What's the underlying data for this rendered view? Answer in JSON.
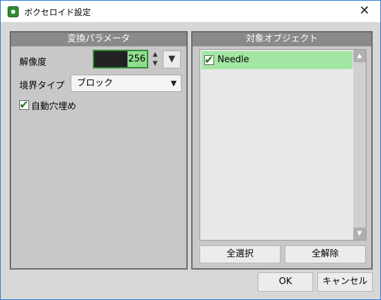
{
  "window": {
    "title": "ボクセロイド設定",
    "close_label": "✕"
  },
  "left_panel": {
    "header": "変換パラメータ",
    "resolution_label": "解像度",
    "resolution_value": "256",
    "spin_up": "▲",
    "spin_down": "▼",
    "dropdown_arrow": "▼",
    "boundary_type_label": "境界タイプ",
    "boundary_type_value": "ブロック",
    "auto_fill_label": "自動穴埋め",
    "auto_fill_checked": true
  },
  "right_panel": {
    "header": "対象オブジェクト",
    "items": [
      {
        "label": "Needle",
        "checked": true
      }
    ],
    "scroll_up": "▲",
    "scroll_down": "▼",
    "select_all_label": "全選択",
    "deselect_all_label": "全解除"
  },
  "footer": {
    "ok_label": "OK",
    "cancel_label": "キャンセル"
  },
  "colors": {
    "accent": "#2f8a2f",
    "selection": "#a3e6a3",
    "panel_header": "#8a8a8a",
    "window_border": "#2b7ad6"
  },
  "icons": {
    "app": "voxeloid-app-icon",
    "check": "checkmark-icon"
  }
}
